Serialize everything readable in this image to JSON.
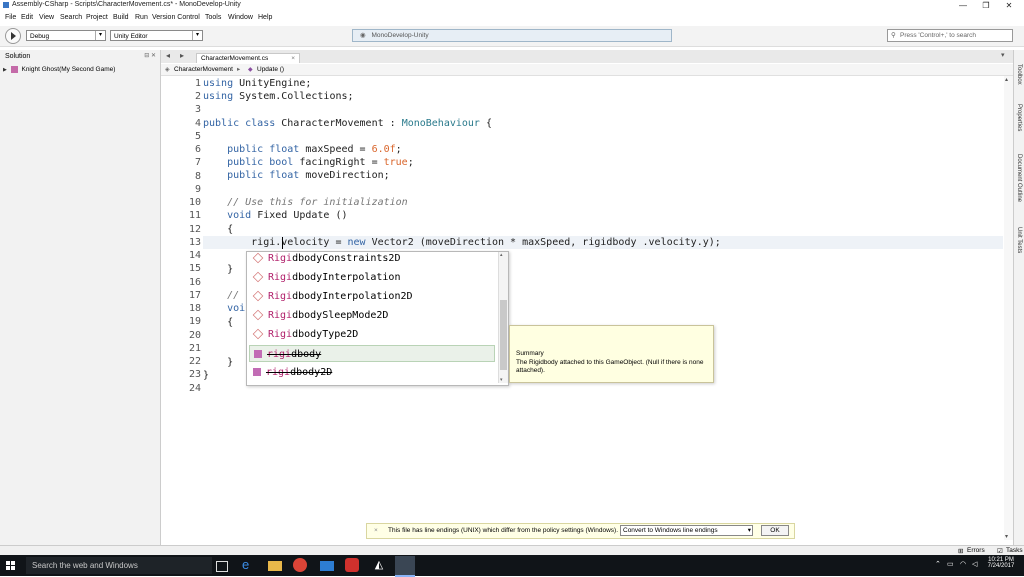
{
  "window": {
    "title": "Assembly-CSharp - Scripts\\CharacterMovement.cs* - MonoDevelop-Unity",
    "controls": {
      "minimize": "—",
      "restore": "❐",
      "close": "✕"
    }
  },
  "menu": [
    "File",
    "Edit",
    "View",
    "Search",
    "Project",
    "Build",
    "Run",
    "Version Control",
    "Tools",
    "Window",
    "Help"
  ],
  "toolbar": {
    "config": "Debug",
    "target": "Unity Editor",
    "status": "MonoDevelop-Unity",
    "search_placeholder": "Press 'Control+,' to search"
  },
  "solution": {
    "header": "Solution",
    "header_buttons": "⊟ ✕",
    "item": "Knight Ghost(My Second Game)"
  },
  "editor": {
    "tab": "CharacterMovement.cs",
    "breadcrumb": {
      "class": "CharacterMovement",
      "method": "Update ()"
    },
    "lines": [
      "1",
      "2",
      "3",
      "4",
      "5",
      "6",
      "7",
      "8",
      "9",
      "10",
      "11",
      "12",
      "13",
      "14",
      "15",
      "16",
      "17",
      "18",
      "19",
      "20",
      "21",
      "22",
      "23",
      "24"
    ]
  },
  "code": {
    "l1a": "using",
    "l1b": " UnityEngine;",
    "l2a": "using",
    "l2b": " System.Collections;",
    "l4a": "public class",
    "l4b": " CharacterMovement : ",
    "l4c": "MonoBehaviour",
    "l4d": " {",
    "l6a": "    public float",
    "l6b": " maxSpeed = ",
    "l6c": "6.0f",
    "l6d": ";",
    "l7a": "    public bool",
    "l7b": " facingRight = ",
    "l7c": "true",
    "l7d": ";",
    "l8a": "    public float",
    "l8b": " moveDirection;",
    "l10": "    // Use this for initialization",
    "l11a": "    void",
    "l11b": " Fixed Update ()",
    "l12": "    {",
    "l13a": "        rigi.velocity = ",
    "l13b": "new",
    "l13c": " Vector2 (moveDirection * maxSpeed, rigidbody .velocity.y);",
    "l15": "    }",
    "l17": "    //",
    "l18": "    voi",
    "l19": "    {",
    "l22": "    }",
    "l23": "}"
  },
  "completion": {
    "items": [
      {
        "match": "Rigi",
        "rest": "dbodyConstraints2D"
      },
      {
        "match": "Rigi",
        "rest": "dbodyInterpolation"
      },
      {
        "match": "Rigi",
        "rest": "dbodyInterpolation2D"
      },
      {
        "match": "Rigi",
        "rest": "dbodySleepMode2D"
      },
      {
        "match": "Rigi",
        "rest": "dbodyType2D"
      },
      {
        "match": "rigi",
        "rest": "dbody"
      },
      {
        "match": "rigi",
        "rest": "dbody2D"
      }
    ]
  },
  "tooltip": {
    "title": "Summary",
    "body": "The Rigidbody attached to this GameObject. (Null if there is none attached)."
  },
  "right_tabs": [
    "Toolbox",
    "Properties",
    "Document Outline",
    "Unit Tests"
  ],
  "infobar": {
    "message": "This file has line endings (UNIX) which differ from the policy settings (Windows).",
    "action": "Convert to Windows line endings",
    "ok": "OK"
  },
  "status": {
    "errors": "Errors",
    "tasks": "Tasks"
  },
  "taskbar": {
    "search": "Search the web and Windows",
    "time": "10:21 PM",
    "date": "7/24/2017"
  }
}
